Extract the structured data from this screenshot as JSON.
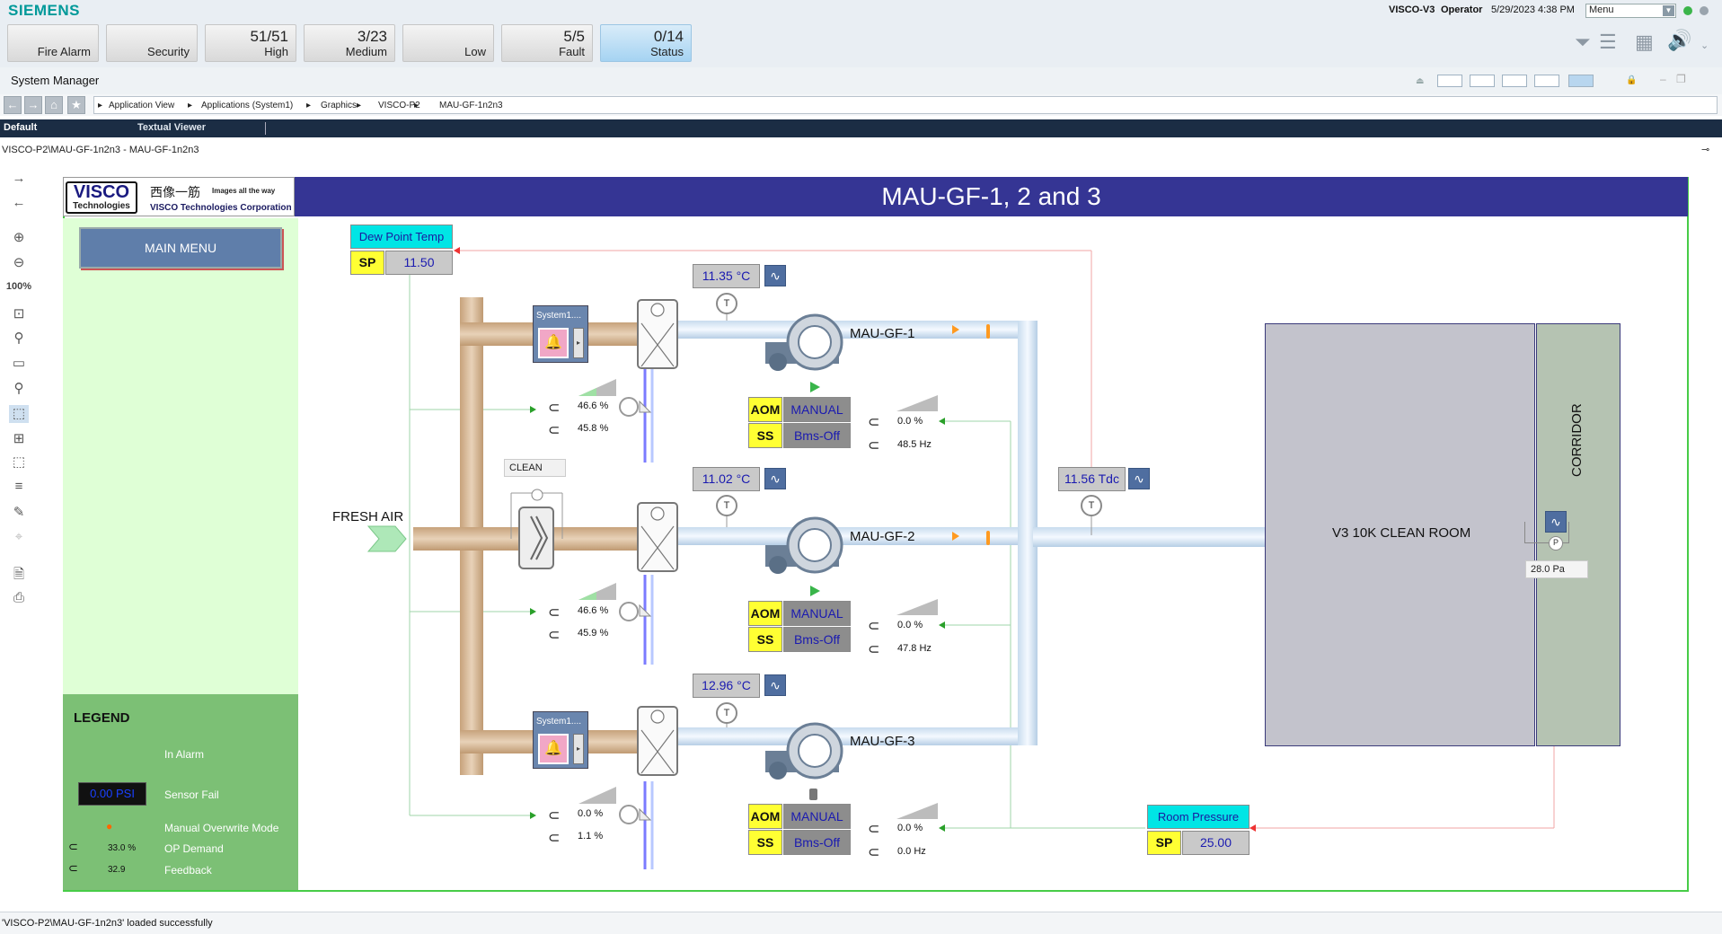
{
  "brand": "SIEMENS",
  "alarms": [
    {
      "count": "",
      "label": "Fire Alarm"
    },
    {
      "count": "",
      "label": "Security"
    },
    {
      "count": "51/51",
      "label": "High"
    },
    {
      "count": "3/23",
      "label": "Medium"
    },
    {
      "count": "",
      "label": "Low"
    },
    {
      "count": "5/5",
      "label": "Fault"
    },
    {
      "count": "0/14",
      "label": "Status"
    }
  ],
  "session": {
    "project": "VISCO-V3",
    "user": "Operator",
    "datetime": "5/29/2023  4:38 PM",
    "menu": "Menu"
  },
  "system_manager": {
    "title": "System Manager"
  },
  "breadcrumb": [
    "Application View",
    "Applications (System1)",
    "Graphics",
    "VISCO-P2",
    "MAU-GF-1n2n3"
  ],
  "tabs": {
    "default": "Default",
    "textual": "Textual Viewer"
  },
  "path_bar": "VISCO-P2\\MAU-GF-1n2n3  -  MAU-GF-1n2n3",
  "left_toolbar": {
    "zoom": "100%"
  },
  "graphic": {
    "title": "MAU-GF-1, 2 and 3",
    "logo_main": "VISCO",
    "logo_sub": "Technologies",
    "logo_chinese": "西像一筋",
    "logo_tagline": "Images all the way",
    "logo_corp": "VISCO Technologies Corporation",
    "main_menu": "MAIN MENU",
    "dew_point": {
      "label": "Dew Point Temp",
      "sp_label": "SP",
      "sp_value": "11.50"
    },
    "fresh_air": "FRESH AIR",
    "clean_label": "CLEAN",
    "system_box_label": "System1....",
    "units": [
      {
        "name": "MAU-GF-1",
        "temp": "11.35 °C",
        "valve_pct": "46.6 %",
        "valve_fb": "45.8 %",
        "aom": "AOM",
        "aom_val": "MANUAL",
        "ss": "SS",
        "ss_val": "Bms-Off",
        "speed_pct": "0.0 %",
        "speed_hz": "48.5 Hz"
      },
      {
        "name": "MAU-GF-2",
        "temp": "11.02 °C",
        "valve_pct": "46.6 %",
        "valve_fb": "45.9 %",
        "aom": "AOM",
        "aom_val": "MANUAL",
        "ss": "SS",
        "ss_val": "Bms-Off",
        "speed_pct": "0.0 %",
        "speed_hz": "47.8 Hz"
      },
      {
        "name": "MAU-GF-3",
        "temp": "12.96 °C",
        "valve_pct": "0.0 %",
        "valve_fb": "1.1 %",
        "aom": "AOM",
        "aom_val": "MANUAL",
        "ss": "SS",
        "ss_val": "Bms-Off",
        "speed_pct": "0.0 %",
        "speed_hz": "0.0 Hz"
      }
    ],
    "supply_temp": "11.56 Tdc",
    "room": "V3 10K CLEAN ROOM",
    "corridor": "CORRIDOR",
    "room_pressure_reading": "28.0 Pa",
    "room_pressure": {
      "label": "Room Pressure",
      "sp_label": "SP",
      "sp_value": "25.00"
    },
    "legend": {
      "title": "LEGEND",
      "in_alarm": "In Alarm",
      "sensor_fail": "Sensor Fail",
      "sensor_fail_value": "0.00 PSI",
      "manual": "Manual Overwrite Mode",
      "op_demand": "OP Demand",
      "op_demand_value": "33.0 %",
      "feedback": "Feedback",
      "feedback_value": "32.9"
    }
  },
  "status_message": "'VISCO-P2\\MAU-GF-1n2n3' loaded successfully"
}
